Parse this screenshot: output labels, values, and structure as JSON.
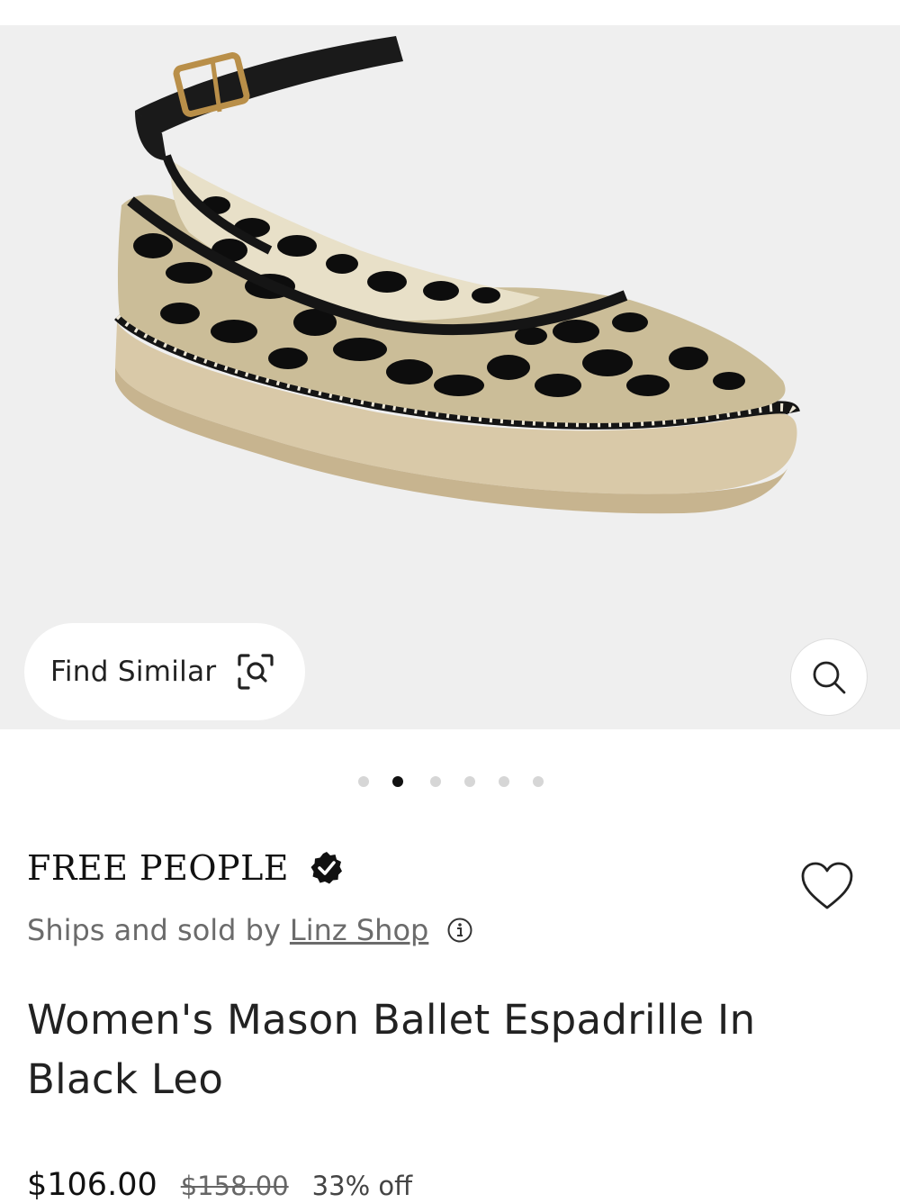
{
  "gallery": {
    "find_similar_label": "Find Similar",
    "image_count": 6,
    "active_index": 1,
    "icons": {
      "find_similar": "visual-search-icon",
      "zoom": "magnifier-icon"
    }
  },
  "product": {
    "brand": "FREE PEOPLE",
    "brand_badge": "verified-check-icon",
    "seller_prefix": "Ships and sold by",
    "seller_name": "Linz Shop",
    "seller_info_icon": "info-icon",
    "title": "Women's Mason Ballet Espadrille In Black Leo",
    "price": "$106.00",
    "original_price": "$158.00",
    "discount": "33% off",
    "wishlist_icon": "heart-outline-icon"
  },
  "colors": {
    "hero_background": "#efefef",
    "active_dot": "#111111",
    "inactive_dot": "#d6d6d6",
    "muted_text": "#6b6b6b"
  }
}
